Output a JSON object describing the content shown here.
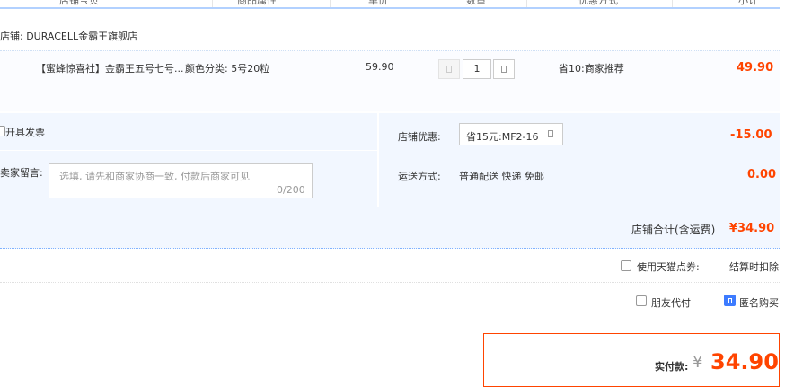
{
  "header": {
    "columns": [
      "店铺宝贝",
      "商品属性",
      "单价",
      "数量",
      "优惠方式",
      "小计"
    ]
  },
  "store": {
    "name": "店铺: DURACELL金霸王旗舰店"
  },
  "item": {
    "title": "【蜜蜂惊喜社】金霸王五号七号...",
    "property": "颜色分类: 5号20粒",
    "price": "59.90",
    "quantity": "1",
    "promo": "省10:商家推荐",
    "subtotal": "49.90"
  },
  "options": {
    "invoice_label": "开具发票",
    "message_label": "卖家留言:",
    "message_placeholder": "选填, 请先和商家协商一致, 付款后商家可见",
    "message_count": "0/200",
    "coupon_label": "店铺优惠:",
    "coupon_selected": "省15元:MF2-16",
    "coupon_amount": "-15.00",
    "shipping_label": "运送方式:",
    "shipping_value": "普通配送 快递 免邮",
    "shipping_amount": "0.00"
  },
  "totals": {
    "store_total_label": "店铺合计(含运费)",
    "store_total_value": "¥34.90",
    "tmall_points_label": "使用天猫点券:",
    "tmall_points_value": "结算时扣除",
    "friend_pay_label": "朋友代付",
    "anonymous_label": "匿名购买",
    "pay_label": "实付款:",
    "pay_currency": "¥",
    "pay_amount": "34.90"
  },
  "colors": {
    "accent": "#ff4400",
    "blue": "#3d7bff",
    "panel": "#f2f7ff"
  }
}
